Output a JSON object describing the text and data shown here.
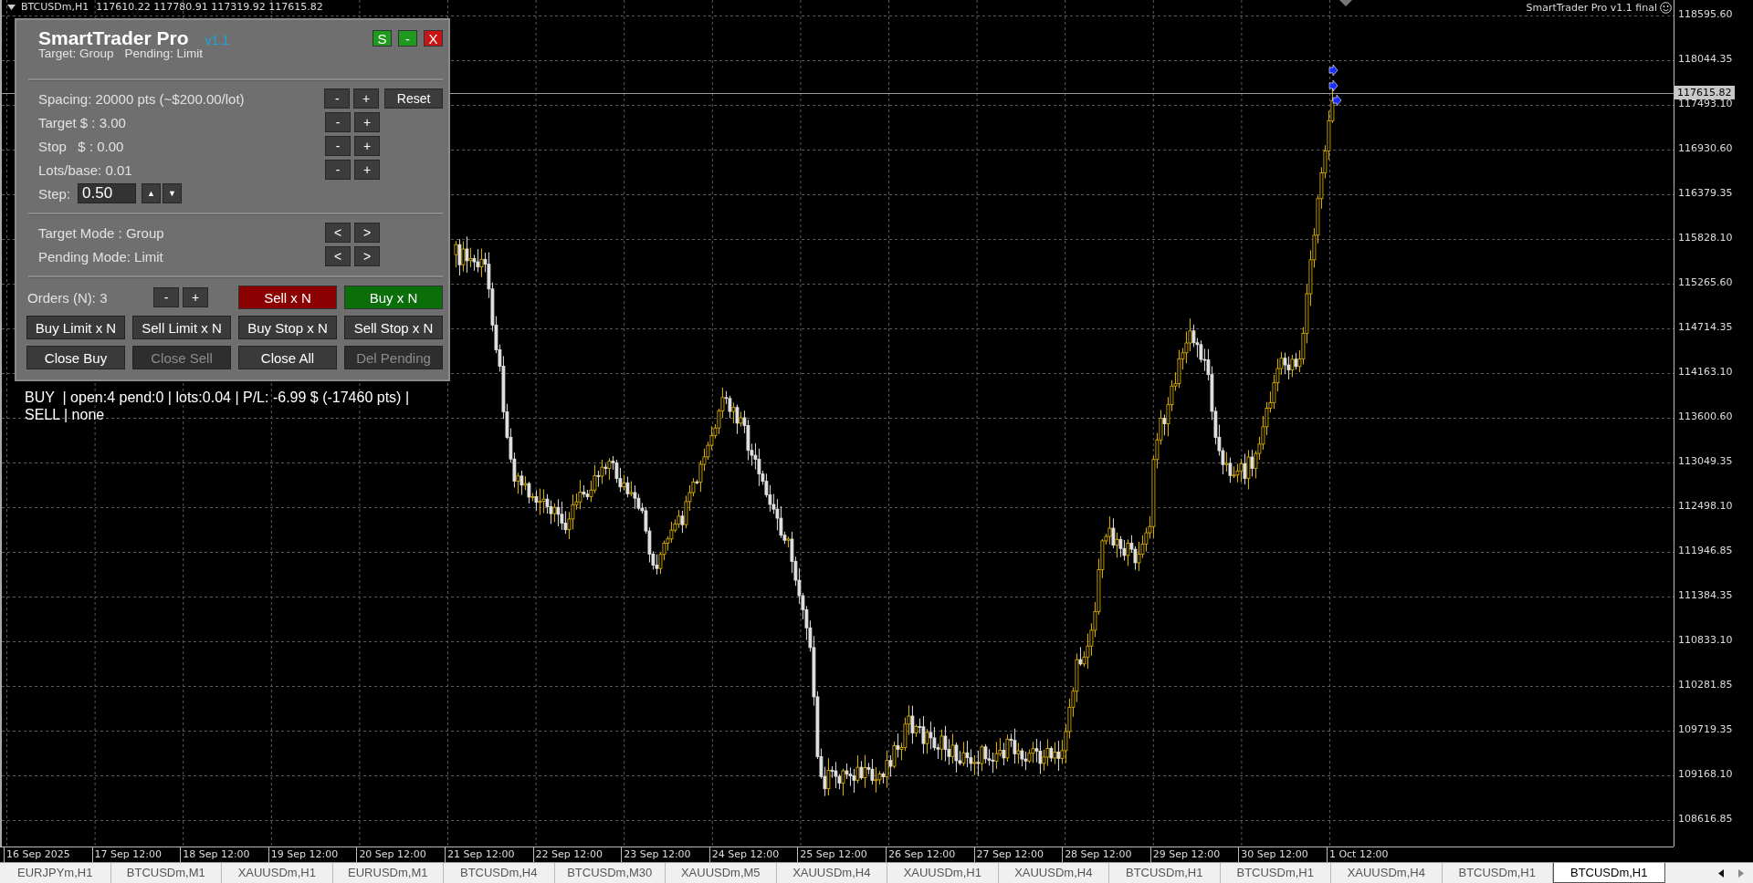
{
  "chart_header": {
    "symbol": "BTCUSDm,H1",
    "ohlc": "117610.22 117780.91 117319.92 117615.82"
  },
  "indicator_label": "SmartTrader Pro v1.1 final",
  "panel": {
    "title": "SmartTrader Pro",
    "version": "v1.1",
    "subtitle": [
      "Target: Group",
      "Pending: Limit"
    ],
    "header_buttons": [
      {
        "label": "S",
        "color": "#1f9a1f"
      },
      {
        "label": "-",
        "color": "#1f9a1f"
      },
      {
        "label": "X",
        "color": "#c81414"
      }
    ],
    "settings": [
      {
        "kind": "adjust",
        "label": "Spacing: 20000 pts (~$200.00/lot)",
        "buttons": [
          "-",
          "+",
          "Reset"
        ]
      },
      {
        "kind": "adjust",
        "label": "Target $ : 3.00",
        "buttons": [
          "-",
          "+"
        ]
      },
      {
        "kind": "adjust",
        "label": "Stop   $ : 0.00",
        "buttons": [
          "-",
          "+"
        ]
      },
      {
        "kind": "adjust",
        "label": "Lots/base: 0.01",
        "buttons": [
          "-",
          "+"
        ]
      },
      {
        "kind": "step",
        "label": "Step:",
        "value": "0.50",
        "buttons": [
          "▲",
          "▼"
        ]
      }
    ],
    "modes": [
      {
        "label": "Target Mode : Group",
        "buttons": [
          "<",
          ">"
        ]
      },
      {
        "label": "Pending Mode: Limit",
        "buttons": [
          "<",
          ">"
        ]
      }
    ],
    "orders": {
      "label": "Orders (N): 3",
      "buttons": [
        "-",
        "+"
      ],
      "actions": [
        {
          "label": "Sell x N",
          "color": "#8b0000"
        },
        {
          "label": "Buy x N",
          "color": "#0a6e0a"
        }
      ]
    },
    "grid_buttons": [
      {
        "label": "Buy Limit x N",
        "disabled": false
      },
      {
        "label": "Sell Limit x N",
        "disabled": false
      },
      {
        "label": "Buy Stop x N",
        "disabled": false
      },
      {
        "label": "Sell Stop x N",
        "disabled": false
      },
      {
        "label": "Close Buy",
        "disabled": false
      },
      {
        "label": "Close Sell",
        "disabled": true
      },
      {
        "label": "Close All",
        "disabled": false
      },
      {
        "label": "Del Pending",
        "disabled": true
      }
    ]
  },
  "status_lines": [
    "BUY  | open:4 pend:0 | lots:0.04 | P/L: -6.99 $ (-17460 pts) |",
    "SELL | none"
  ],
  "price_axis": {
    "labels": [
      "118595.60",
      "118044.35",
      "117493.10",
      "116930.60",
      "116379.35",
      "115828.10",
      "115265.60",
      "114714.35",
      "114163.10",
      "113600.60",
      "113049.35",
      "112498.10",
      "111946.85",
      "111384.35",
      "110833.10",
      "110281.85",
      "109719.35",
      "109168.10",
      "108616.85"
    ],
    "current_price": "117615.82"
  },
  "time_axis": [
    "16 Sep 2025",
    "17 Sep 12:00",
    "18 Sep 12:00",
    "19 Sep 12:00",
    "20 Sep 12:00",
    "21 Sep 12:00",
    "22 Sep 12:00",
    "23 Sep 12:00",
    "24 Sep 12:00",
    "25 Sep 12:00",
    "26 Sep 12:00",
    "27 Sep 12:00",
    "28 Sep 12:00",
    "29 Sep 12:00",
    "30 Sep 12:00",
    "1 Oct 12:00"
  ],
  "tabs": [
    {
      "label": "EURJPYm,H1",
      "selected": false
    },
    {
      "label": "BTCUSDm,M1",
      "selected": false
    },
    {
      "label": "XAUUSDm,H1",
      "selected": false
    },
    {
      "label": "EURUSDm,M1",
      "selected": false
    },
    {
      "label": "BTCUSDm,H4",
      "selected": false
    },
    {
      "label": "BTCUSDm,M30",
      "selected": false
    },
    {
      "label": "XAUUSDm,M5",
      "selected": false
    },
    {
      "label": "XAUUSDm,H4",
      "selected": false
    },
    {
      "label": "XAUUSDm,H1",
      "selected": false
    },
    {
      "label": "XAUUSDm,H4",
      "selected": false
    },
    {
      "label": "BTCUSDm,H1",
      "selected": false
    },
    {
      "label": "BTCUSDm,H1",
      "selected": false
    },
    {
      "label": "XAUUSDm,H4",
      "selected": false
    },
    {
      "label": "BTCUSDm,H1",
      "selected": false
    },
    {
      "label": "BTCUSDm,H1",
      "selected": true
    }
  ]
}
